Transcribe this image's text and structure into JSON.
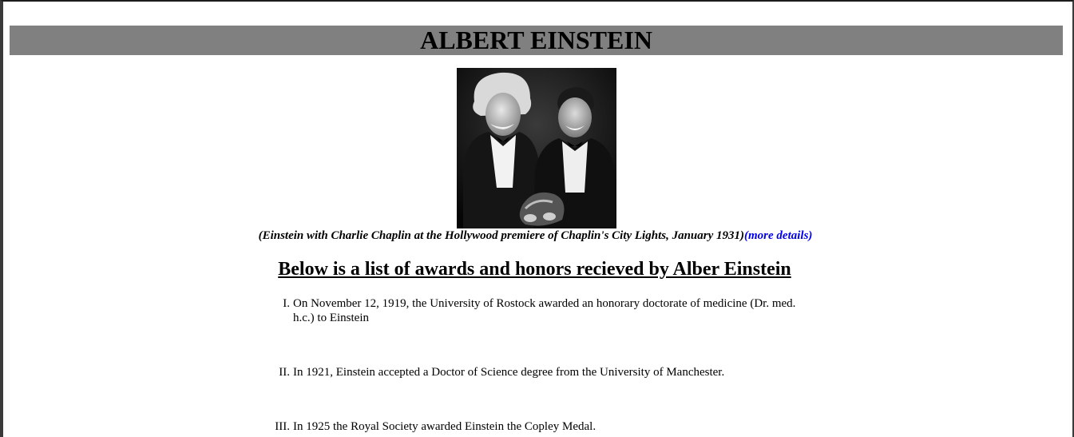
{
  "page": {
    "title": "ALBERT EINSTEIN"
  },
  "photo": {
    "alt": "Einstein with Charlie Chaplin"
  },
  "caption": {
    "text": "(Einstein with Charlie Chaplin at the Hollywood premiere of Chaplin's City Lights, January 1931)",
    "link_label": "(more details)"
  },
  "awards": {
    "heading": "Below is a list of awards and honors recieved by Alber Einstein",
    "items": [
      {
        "numeral": "I.",
        "text": "On November 12, 1919, the University of Rostock awarded an honorary doctorate of medicine (Dr. med. h.c.) to Einstein"
      },
      {
        "numeral": "II.",
        "text": "In 1921, Einstein accepted a Doctor of Science degree from the University of Manchester."
      },
      {
        "numeral": "III.",
        "text": "In 1925 the Royal Society awarded Einstein the Copley Medal."
      }
    ]
  },
  "colors": {
    "banner_bg": "#808080",
    "link": "#0000ee"
  }
}
